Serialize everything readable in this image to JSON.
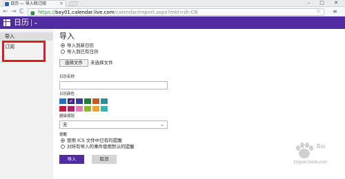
{
  "browser": {
    "tab_title": "日历 — 导入和订阅",
    "window_controls": "– □ ✕",
    "url_https": "https://",
    "url_host": "bay01.calendar.live.com",
    "url_path": "/calendar/import.aspx?mkt=zh-CN",
    "nav_back": "←",
    "nav_forward": "→",
    "nav_reload": "C"
  },
  "app": {
    "title": "日历",
    "accent_color": "#4f2c9f"
  },
  "sidebar": {
    "section": "导入",
    "items": [
      {
        "label": "订阅"
      }
    ]
  },
  "main": {
    "heading": "导入",
    "import_options": [
      {
        "label": "导入到新日历",
        "selected": true
      },
      {
        "label": "导入到已有日历",
        "selected": false
      }
    ],
    "choose_file_label": "选择文件",
    "no_file_text": "未选择文件",
    "calendar_name_label": "日历名称",
    "calendar_name_value": "",
    "calendar_color_label": "日历颜色",
    "colors": [
      {
        "hex": "#2572b8",
        "selected": false
      },
      {
        "hex": "#4f2c9f",
        "selected": true
      },
      {
        "hex": "#3a3a9e",
        "selected": false
      },
      {
        "hex": "#1f7f3a",
        "selected": false
      },
      {
        "hex": "#c45a1e",
        "selected": false
      },
      {
        "hex": "#2a8f9b",
        "selected": false
      },
      {
        "hex": "#c7173f",
        "selected": false
      },
      {
        "hex": "#a4296d",
        "selected": false
      },
      {
        "hex": "#e87ab6",
        "selected": false
      },
      {
        "hex": "#8db52b",
        "selected": false
      },
      {
        "hex": "#f0a22a",
        "selected": false
      },
      {
        "hex": "#34b3b3",
        "selected": false
      }
    ],
    "charm_label": "超级按钮",
    "charm_value": "无",
    "reminder_label": "提醒",
    "reminder_options": [
      {
        "label": "使用 ICS 文件中已有的提醒",
        "selected": true
      },
      {
        "label": "对所有导入的事件使用默认的提醒",
        "selected": false
      }
    ],
    "import_button": "导入",
    "cancel_button": "取消"
  },
  "watermark": {
    "text": "jingyan.baidu.com",
    "brand": "Bai"
  }
}
